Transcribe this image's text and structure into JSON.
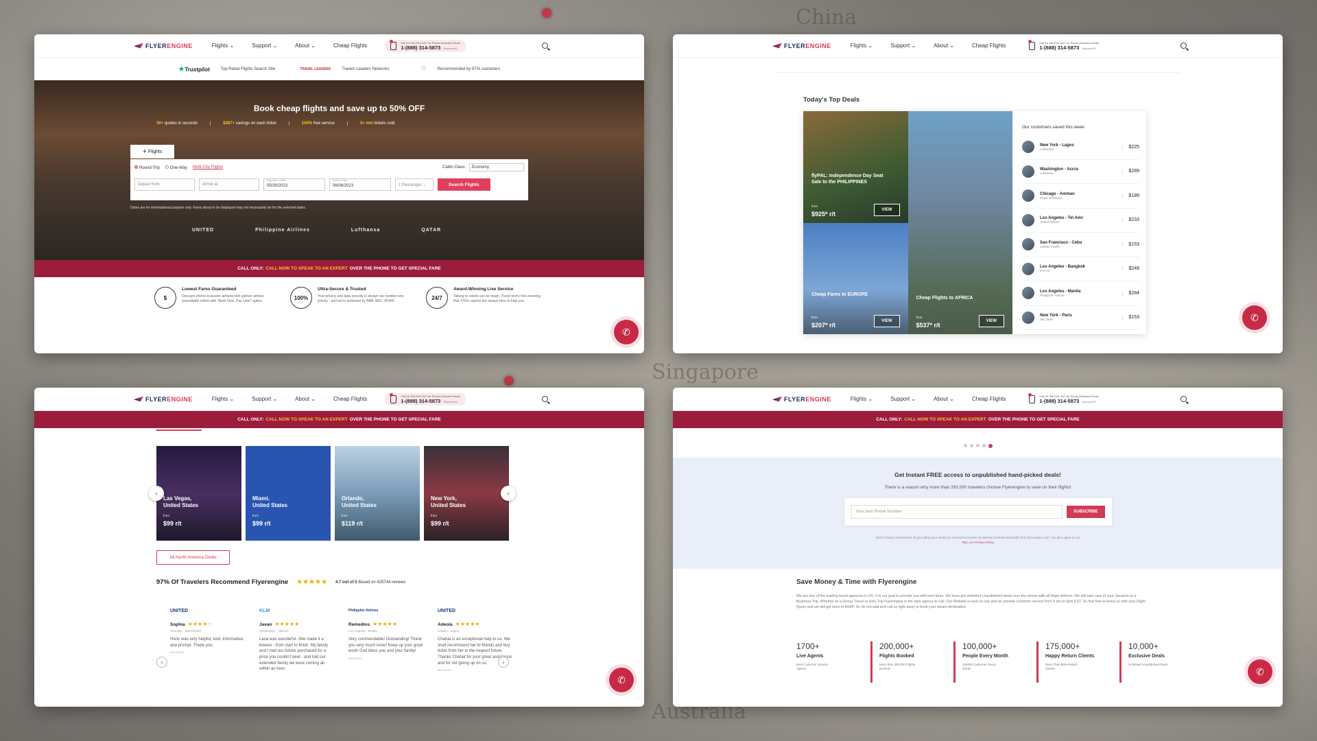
{
  "nav": {
    "logo_a": "FLYER",
    "logo_b": "ENGINE",
    "items": [
      "Flights ⌄",
      "Support ⌄",
      "About ⌄",
      "Cheap Flights"
    ],
    "phone_small": "Call Us Toll-Free 24/7 for Phone-Exclusive Deals",
    "phone_number": "1-(888) 314-5873",
    "phone_discount": "Discount ID"
  },
  "panel1": {
    "trust": {
      "trustpilot": "Trustpilot",
      "trustpilot_text": "Top Rated Flights Search Site",
      "tls": "TRAVEL LEADERS",
      "tls_text": "Travels Leaders Networks",
      "recommended": "Recommended by 97% customers"
    },
    "hero_title": "Book cheap flights and save up to 50% OFF",
    "stats": [
      {
        "b": "30+",
        "t": " quotes in seconds"
      },
      {
        "b": "$287+",
        "t": " savings on each ticket"
      },
      {
        "b": "100%",
        "t": " free service"
      },
      {
        "b": "3+ min",
        "t": " tickets sold"
      }
    ],
    "tab": "Flights",
    "round_trip": "Round-Trip",
    "one_way": "One-Way",
    "multi_city": "Multi-City Flights",
    "cabin_label": "Cabin Class:",
    "cabin_value": "Economy",
    "depart_placeholder": "Depart from",
    "arrive_placeholder": "Arrive at",
    "depart_date_label": "Departure Date",
    "depart_date": "05/30/2023",
    "return_date_label": "Return Date",
    "return_date": "06/06/2023",
    "passengers": "1 Passenger ⌄",
    "search_button": "Search Flights",
    "disclaimer": "Dates are for informational purpose only. Fares about to be displayed may not necessarily be for the selected dates.",
    "airlines": [
      "UNITED",
      "Philippine Airlines",
      "Lufthansa",
      "QATAR"
    ],
    "features": [
      {
        "title": "Lowest Fares Guaranteed",
        "text": "Discount phone-exclusive airfares with partner airlines unavailable online with \"Book Now, Pay Later\" option.",
        "icon": "$"
      },
      {
        "title": "Ultra-Secure & Trusted",
        "text": "Your privacy and data security is always our number-one priority - and we're endorsed by BBB, ARC, IATAN.",
        "icon": "100%"
      },
      {
        "title": "Award-Winning Live Service",
        "text": "Talking to robots can be tough. Travel worry-free knowing that 1700+ agents are always here to help you.",
        "icon": "24/7"
      }
    ]
  },
  "callbar": {
    "pre": "CALL ONLY:",
    "hl": "CALL NOW TO SPEAK TO AN EXPERT",
    "post": "OVER THE PHONE TO GET SPECIAL FARE"
  },
  "panel2": {
    "title": "Today's Top Deals",
    "deals": [
      {
        "title": "flyPAL: Independence Day Seat Sale to the PHILIPPINES",
        "from": "from",
        "price": "$925* r/t",
        "view": "VIEW"
      },
      {
        "title": "Cheap Flights to AFRICA",
        "from": "from",
        "price": "$537* r/t",
        "view": "VIEW"
      },
      {
        "title": "Cheap Fares to EUROPE",
        "from": "from",
        "price": "$207* r/t",
        "view": "VIEW"
      }
    ],
    "saved_title": "Our customers saved this week:",
    "saved": [
      {
        "route": "New York - Lagos",
        "airline": "Lufthansa",
        "price": "$225"
      },
      {
        "route": "Washington - Accra",
        "airline": "Lufthansa",
        "price": "$289"
      },
      {
        "route": "Chicago - Amman",
        "airline": "Royal Jordanian",
        "price": "$189"
      },
      {
        "route": "Los Angeles - Tel Aviv",
        "airline": "United Airlines",
        "price": "$233"
      },
      {
        "route": "San Francisco - Cebu",
        "airline": "Cathay Pacific",
        "price": "$153"
      },
      {
        "route": "Los Angeles - Bangkok",
        "airline": "EVA Air",
        "price": "$248"
      },
      {
        "route": "Los Angeles - Manila",
        "airline": "Philippine Airlines",
        "price": "$284"
      },
      {
        "route": "New York - Paris",
        "airline": "Sky Team",
        "price": "$153"
      }
    ]
  },
  "panel3": {
    "cards": [
      {
        "city": "Las Vegas,",
        "country": "United States",
        "from": "from",
        "price": "$99 r/t"
      },
      {
        "city": "Miami,",
        "country": "United States",
        "from": "from",
        "price": "$99 r/t"
      },
      {
        "city": "Orlando,",
        "country": "United States",
        "from": "from",
        "price": "$119 r/t"
      },
      {
        "city": "New York,",
        "country": "United States",
        "from": "from",
        "price": "$99 r/t"
      }
    ],
    "all_deals": "All North America Deals",
    "reco_title": "97% Of Travelers Recommend Flyerengine",
    "rating_text": "4.7 out of 5",
    "rating_based": "Based on 425744 reviews",
    "reviews": [
      {
        "logo": "UNITED",
        "name": "Sophia",
        "stars": "★★★★☆",
        "loc": "Honolulu - Manchester",
        "text": "Hertz was very helpful, kind, informative, and prompt. Thank you.",
        "date": "06/19/2022"
      },
      {
        "logo": "KLM",
        "name": "Javan",
        "stars": "★★★★★",
        "loc": "Washington - Nairobi",
        "text": "Lana was wonderful. She made it a breeze - from start to finish. My family and I had our tickets purchased for a price you couldn't beat - and told our extended family we were coming all within an hour.",
        "date": ""
      },
      {
        "logo": "Philippine Airlines",
        "name": "Remedios",
        "stars": "★★★★★",
        "loc": "Los Angeles - Manila",
        "text": "Very commendable! Outstanding! Thank you very much Anne! Keep up your good work! God bless you and your family!",
        "date": "06/19/2022"
      },
      {
        "logo": "UNITED",
        "name": "Adeola",
        "stars": "★★★★★",
        "loc": "Ontario - Lagos",
        "text": "Chahat is an exceptional help to us. We shall recommend her to friends and buy ticket from her in the nearest future. Thanks Chahat for your great assistance and for not giving up on us.",
        "date": "06/19/2022"
      }
    ]
  },
  "panel4": {
    "nl_title": "Get Instant FREE access to unpublished hand-picked deals!",
    "nl_sub": "There is a reason why more than 292,000 travelers choose Flyerengine to save on their flights!",
    "nl_placeholder": "Your best Phone Number",
    "nl_button": "SUBSCRIBE",
    "nl_fine": "100% Privacy Guaranteed. By providing your email you consent to receive occasional promotional Emails from flyerengine.com. You also agree to our",
    "nl_tc": "T&C",
    "nl_and": "and",
    "nl_pp": "Privacy Policy",
    "save_title": "Save Money & Time with Flyerengine",
    "save_text": "We are one of the leading travel agencies in US. It is our goal to provide you with best fares. We have got unlimited Unpublished deals over the phone with all Major Airlines. We will take care of your Vacation or a Business Trip. Whether its a Group Travel or Solo Trip Flyerengine is the right agency to call. Our Website is easy to use and we provide customer service from 9 am to 6pm EST. So feel free to leave us with your Flight Query and we will get back to ASAP. So do not wait and call us right away to book your dream destination.",
    "stats": [
      {
        "num": "1700+",
        "label": "Live Agents",
        "desc": "Best Customer Service Agents"
      },
      {
        "num": "200,000+",
        "label": "Flights Booked",
        "desc": "More than 200,000 Flights Booked"
      },
      {
        "num": "100,000+",
        "label": "People Every Month",
        "desc": "100000 Customer Every Month"
      },
      {
        "num": "175,000+",
        "label": "Happy Return Clients",
        "desc": "More Than 80% Return Clients"
      },
      {
        "num": "10,000+",
        "label": "Exclusive Deals",
        "desc": "Unlimited Unpublished Deals"
      }
    ]
  },
  "background": {
    "words": [
      "China",
      "Singapore",
      "Australia"
    ]
  }
}
